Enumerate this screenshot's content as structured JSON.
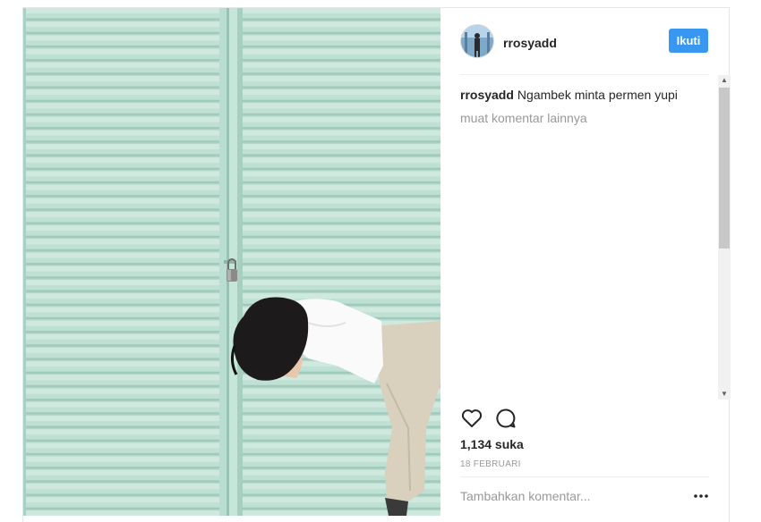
{
  "post": {
    "username": "rrosyadd",
    "follow_label": "Ikuti",
    "caption_user": "rrosyadd",
    "caption_text": "Ngambek minta permen yupi",
    "load_more": "muat komentar lainnya",
    "likes": "1,134 suka",
    "date": "18 FEBRUARI",
    "comment_placeholder": "Tambahkan komentar..."
  },
  "icons": {
    "like": "heart-icon",
    "comment": "comment-icon",
    "more": "more-options-icon",
    "scroll_up": "scroll-up-arrow-icon",
    "scroll_down": "scroll-down-arrow-icon"
  },
  "colors": {
    "accent": "#3897f0",
    "shutter": "#bfe0d4",
    "text": "#262626",
    "muted": "#999999"
  }
}
